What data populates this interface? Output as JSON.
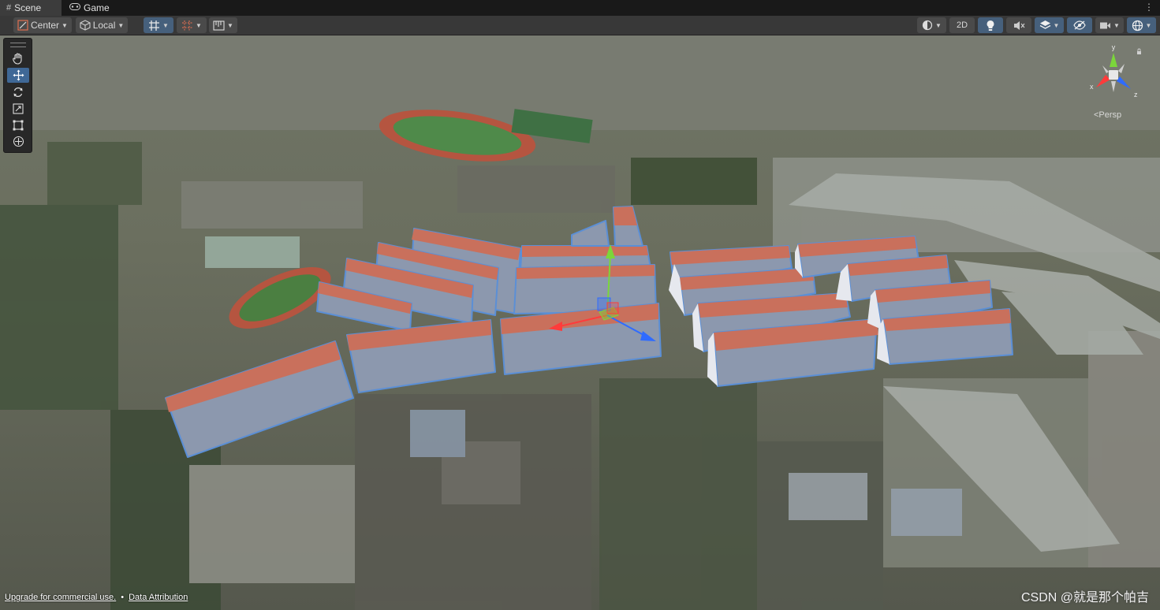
{
  "tabs": [
    {
      "label": "Scene",
      "icon": "hash-icon",
      "active": true
    },
    {
      "label": "Game",
      "icon": "gamepad-icon",
      "active": false
    }
  ],
  "toolbar": {
    "pivot_label": "Center",
    "handle_rotation_label": "Local",
    "mode_2d_label": "2D"
  },
  "viewport": {
    "projection_label": "<Persp",
    "gizmo_axes": {
      "x": "x",
      "y": "y",
      "z": "z"
    },
    "colors": {
      "x_axis": "#ff3b3b",
      "y_axis": "#7bd63a",
      "z_axis": "#2f6bff",
      "selection_outline": "#5b8fd6",
      "building_wall": "#8c98ae",
      "roof": "#c9705c"
    }
  },
  "footer": {
    "upgrade_link": "Upgrade for commercial use.",
    "separator": "•",
    "attribution_link": "Data Attribution"
  },
  "watermark": "CSDN @就是那个帕吉"
}
